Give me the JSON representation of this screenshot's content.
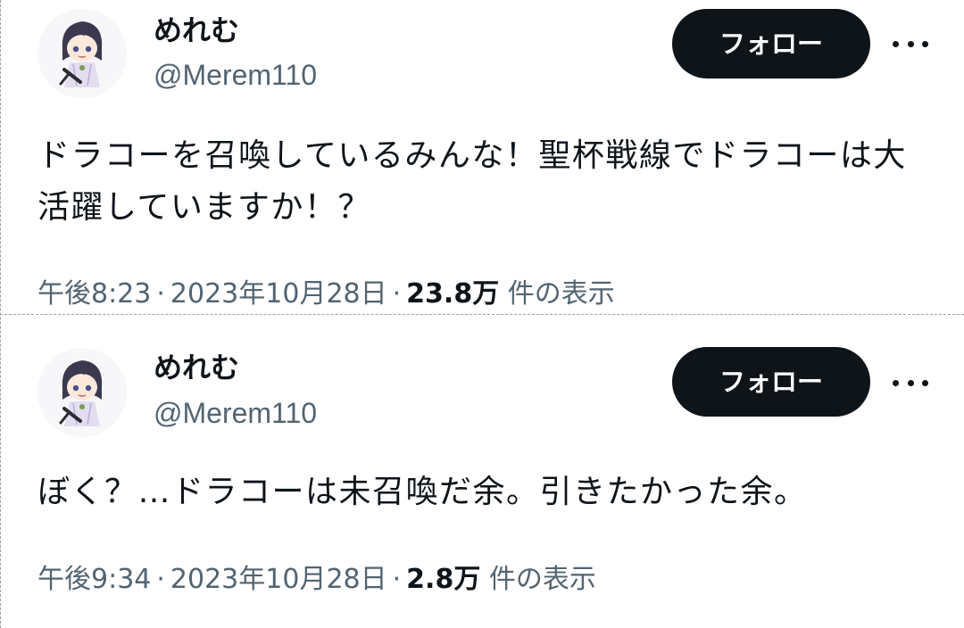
{
  "tweets": [
    {
      "author": {
        "display_name": "めれむ",
        "handle": "@Merem110"
      },
      "follow_label": "フォロー",
      "more_icon": "more-horizontal-icon",
      "text": "ドラコーを召喚しているみんな！聖杯戦線でドラコーは大活躍していますか！？",
      "time": "午後8:23",
      "date": "2023年10月28日",
      "views_count": "23.8万",
      "views_label": "件の表示"
    },
    {
      "author": {
        "display_name": "めれむ",
        "handle": "@Merem110"
      },
      "follow_label": "フォロー",
      "more_icon": "more-horizontal-icon",
      "text": "ぼく？…ドラコーは未召喚だ余。引きたかった余。",
      "time": "午後9:34",
      "date": "2023年10月28日",
      "views_count": "2.8万",
      "views_label": "件の表示"
    }
  ],
  "separator_char": "·",
  "colors": {
    "text_primary": "#0f1419",
    "text_secondary": "#536471",
    "button_bg": "#0f1419",
    "button_text": "#ffffff",
    "background": "#ffffff"
  }
}
